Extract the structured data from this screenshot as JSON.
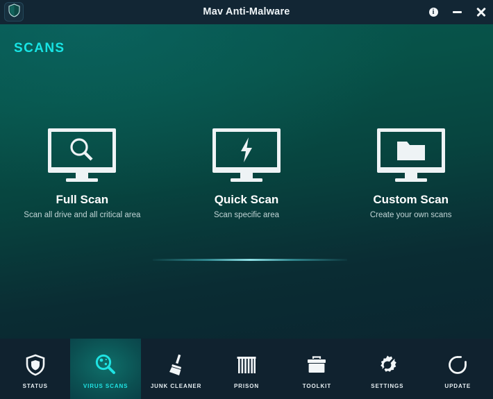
{
  "window": {
    "title": "Mav Anti-Malware",
    "logo_icon": "shield-icon",
    "controls": [
      {
        "name": "info-button",
        "icon": "info-icon",
        "glyph": "i"
      },
      {
        "name": "minimize-button",
        "icon": "minimize-icon",
        "glyph": "–"
      },
      {
        "name": "close-button",
        "icon": "close-icon",
        "glyph": "✕"
      }
    ]
  },
  "page": {
    "section_title": "SCANS"
  },
  "scan_cards": [
    {
      "title": "Full Scan",
      "subtitle": "Scan all drive and all critical area",
      "icon": "magnifier-icon"
    },
    {
      "title": "Quick Scan",
      "subtitle": "Scan specific area",
      "icon": "lightning-bolt-icon"
    },
    {
      "title": "Custom Scan",
      "subtitle": "Create your own scans",
      "icon": "folder-icon"
    }
  ],
  "nav": {
    "active_index": 1,
    "items": [
      {
        "label": "STATUS",
        "icon": "shield-icon"
      },
      {
        "label": "VIRUS SCANS",
        "icon": "virus-magnifier-icon"
      },
      {
        "label": "JUNK CLEANER",
        "icon": "broom-icon"
      },
      {
        "label": "PRISON",
        "icon": "jail-bars-icon"
      },
      {
        "label": "TOOLKIT",
        "icon": "toolbox-icon"
      },
      {
        "label": "SETTINGS",
        "icon": "gear-icon"
      },
      {
        "label": "UPDATE",
        "icon": "refresh-icon"
      }
    ]
  },
  "colors": {
    "accent_cyan": "#17e4e4",
    "titlebar_bg": "#122634",
    "navbar_bg": "#10222f",
    "content_top": "#07564f",
    "content_bottom": "#0b2630",
    "icon_white": "#eef3f5"
  }
}
